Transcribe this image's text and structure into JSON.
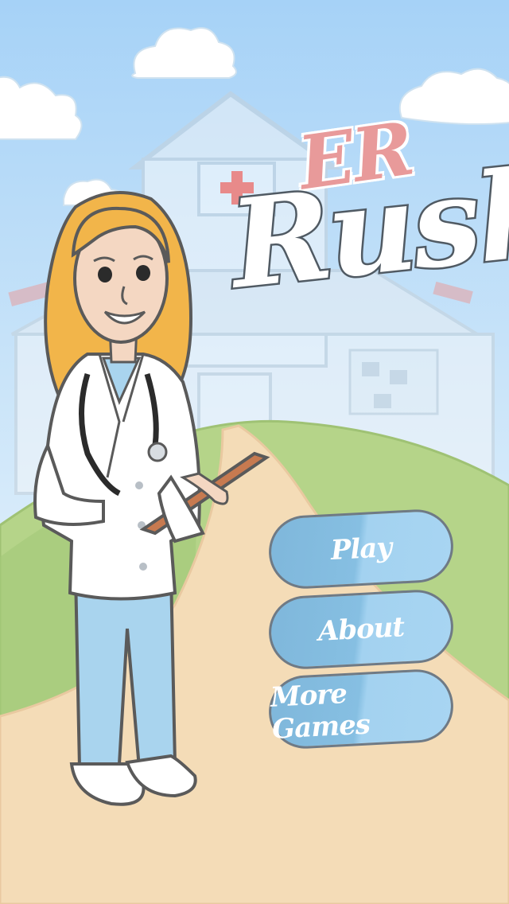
{
  "title": {
    "line1": "ER",
    "line2": "Rush"
  },
  "menu": {
    "play_label": "Play",
    "about_label": "About",
    "more_games_label": "More Games"
  },
  "colors": {
    "sky_top": "#a6d2f7",
    "sky_bottom": "#e3f1fa",
    "hill": "#b7d58a",
    "path": "#f5dcb8",
    "title_accent": "#e89a9a",
    "button": "#8cc3e6",
    "hair": "#f2b54a",
    "scrubs": "#a9d4ee"
  }
}
